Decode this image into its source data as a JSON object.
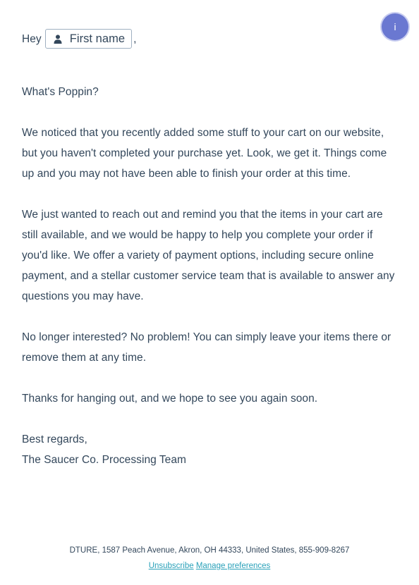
{
  "greeting": {
    "prefix": "Hey",
    "token_label": "First name",
    "suffix": ","
  },
  "body": {
    "paragraphs": [
      "What's Poppin?",
      "We noticed that you recently added some stuff to your cart on our website, but you haven't completed your purchase yet. Look, we get it. Things come up and you may not have been able to finish your order at this time.",
      "We just wanted to reach out and remind you that the items in your cart are still available, and we would be happy to help you complete your order if you'd like. We offer a variety of payment options, including secure online payment, and a stellar customer service team that is available to answer any questions you may have.",
      "No longer interested? No problem! You can simply leave your items there or remove them at any time.",
      "Thanks for hanging out, and we hope to see you again soon."
    ],
    "closing": "Best regards,",
    "signature": "The Saucer Co. Processing Team"
  },
  "footer": {
    "address": "DTURE, 1587 Peach Avenue, Akron, OH 44333, United States, 855-909-8267",
    "unsubscribe": "Unsubscribe",
    "manage": "Manage preferences"
  },
  "info_badge": {
    "label": "i",
    "color": "#6a78d1"
  },
  "colors": {
    "text": "#33475b",
    "link": "#2aa1b9"
  }
}
